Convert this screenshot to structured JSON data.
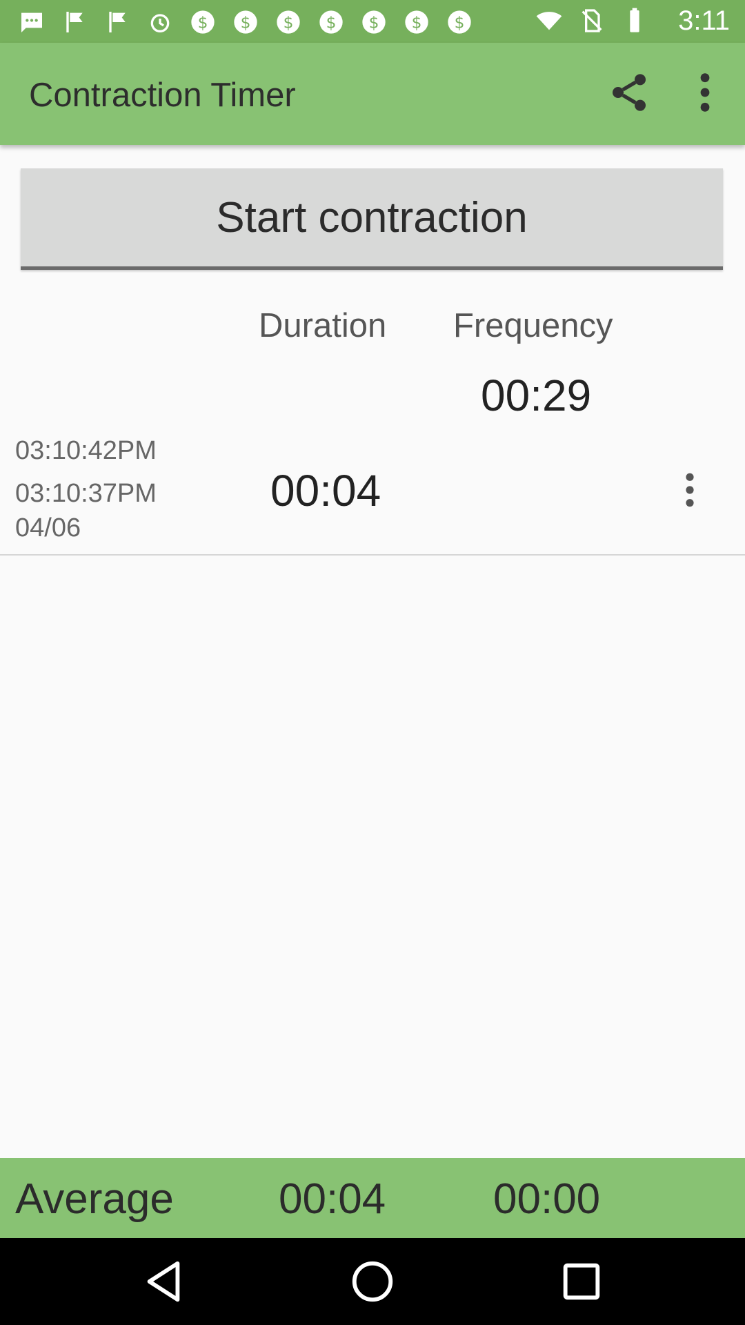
{
  "status_bar": {
    "time": "3:11",
    "icons": [
      "chat-icon",
      "flag-icon",
      "flag-icon",
      "alarm-icon",
      "dollar-icon",
      "dollar-icon",
      "dollar-icon",
      "dollar-icon",
      "dollar-icon",
      "dollar-icon",
      "dollar-icon",
      "wifi-icon",
      "no-sim-icon",
      "battery-icon"
    ]
  },
  "app_bar": {
    "title": "Contraction Timer",
    "actions": [
      "share-icon",
      "overflow-menu-icon"
    ]
  },
  "start_button": {
    "label": "Start contraction"
  },
  "table": {
    "headers": {
      "duration": "Duration",
      "frequency": "Frequency"
    },
    "frequency_value": "00:29",
    "rows": [
      {
        "end_time": "03:10:42PM",
        "start_time": "03:10:37PM",
        "date": "04/06",
        "duration": "00:04"
      }
    ]
  },
  "footer": {
    "label": "Average",
    "duration": "00:04",
    "frequency": "00:00"
  },
  "colors": {
    "status_bar": "#76b05c",
    "app_bar": "#88c273",
    "button": "#d8d9d8",
    "background": "#fafafa"
  }
}
